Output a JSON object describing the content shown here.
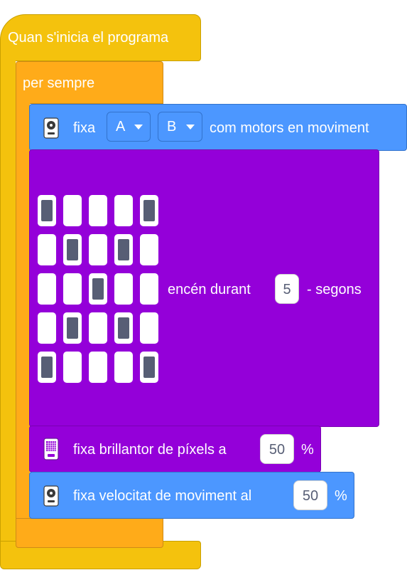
{
  "hat": {
    "label": "Quan s'inicia el programa"
  },
  "forever": {
    "label": "per sempre"
  },
  "motors_block": {
    "label_set": "fixa",
    "dropdown_a": "A",
    "dropdown_b": "B",
    "label_tail": "com motors en moviment",
    "icon": "remote-control-icon"
  },
  "led_block": {
    "grid": [
      [
        1,
        0,
        0,
        0,
        1
      ],
      [
        0,
        1,
        0,
        1,
        0
      ],
      [
        0,
        0,
        1,
        0,
        0
      ],
      [
        0,
        1,
        0,
        1,
        0
      ],
      [
        1,
        0,
        0,
        0,
        1
      ]
    ],
    "label": "encén durant",
    "duration": "5",
    "unit": "- segons"
  },
  "brightness_block": {
    "label": "fixa brillantor de píxels a",
    "value": "50",
    "unit": "%",
    "icon": "led-matrix-icon"
  },
  "speed_block": {
    "label": "fixa velocitat de moviment al",
    "value": "50",
    "unit": "%",
    "icon": "remote-control-icon"
  },
  "colors": {
    "events": "#f4c20d",
    "control": "#ffab19",
    "motion": "#4c97ff",
    "looks": "#9400d9"
  }
}
